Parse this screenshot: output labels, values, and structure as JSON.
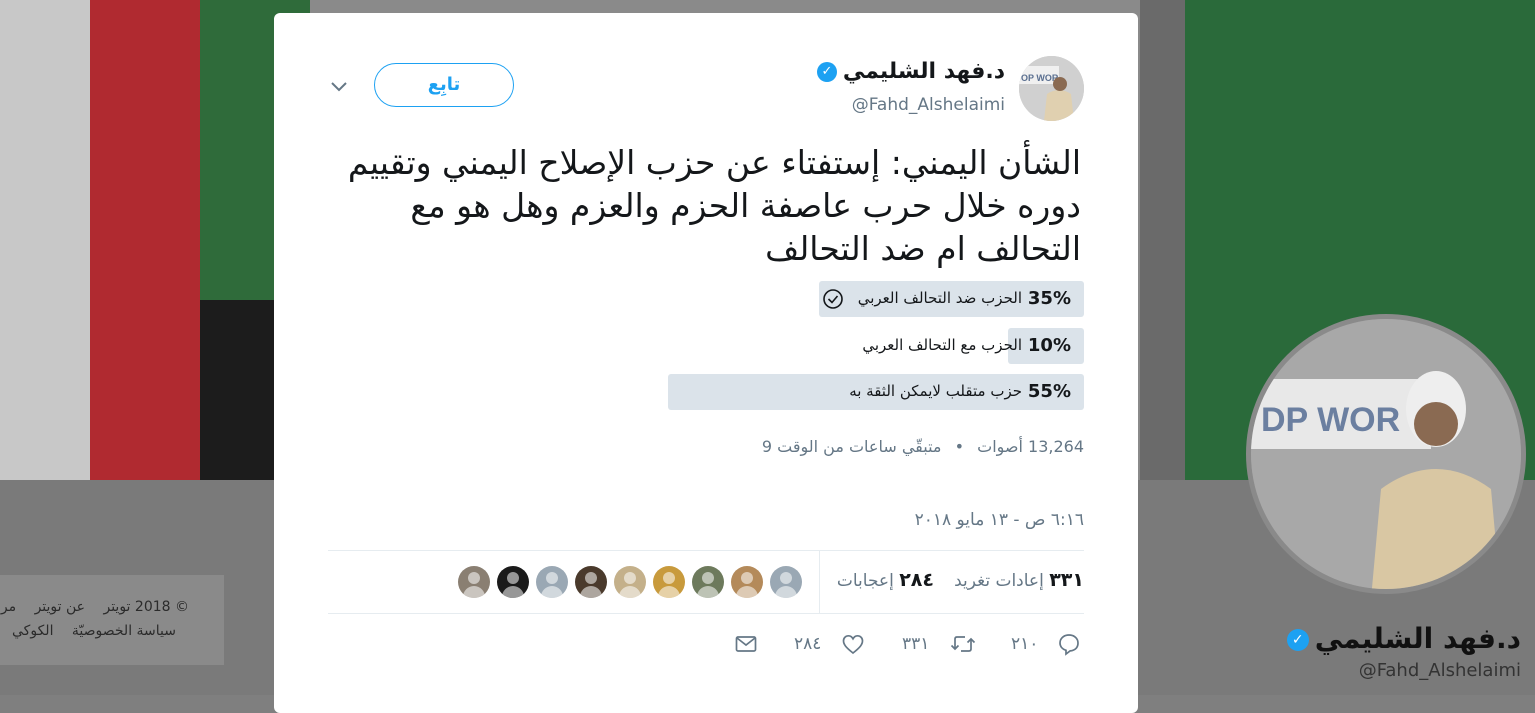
{
  "footer": {
    "line1": [
      "© 2018 تويتر",
      "عن تويتر",
      "مر"
    ],
    "line2": [
      "سياسة الخصوصيّة",
      "الكوكي"
    ]
  },
  "profile": {
    "name": "د.فهد الشليمي",
    "handle": "@Fahd_Alshelaimi"
  },
  "tweet": {
    "author_name": "د.فهد الشليمي",
    "author_handle": "@Fahd_Alshelaimi",
    "follow_label": "تابِع",
    "text": "الشأن اليمني: إستفتاء عن حزب الإصلاح اليمني وتقييم دوره خلال حرب عاصفة الحزم والعزم وهل هو مع التحالف ام ضد التحالف",
    "poll": {
      "options": [
        {
          "pct_label": "35%",
          "label": "الحزب ضد التحالف العربي",
          "fraction": 0.35,
          "selected": true
        },
        {
          "pct_label": "10%",
          "label": "الحزب مع التحالف العربي",
          "fraction": 0.1,
          "selected": false
        },
        {
          "pct_label": "55%",
          "label": "حزب متقلب لايمكن الثقة به",
          "fraction": 0.55,
          "selected": false
        }
      ],
      "votes": "13,264 أصوات",
      "separator": "•",
      "time_left": "متبقّي ساعات من الوقت 9"
    },
    "timestamp": "٦:١٦ ص - ١٣ مايو ٢٠١٨",
    "stats": {
      "retweets_count": "٣٣١",
      "retweets_label": "إعادات تغريد",
      "likes_count": "٢٨٤",
      "likes_label": "إعجابات"
    },
    "actions": {
      "reply_count": "٢١٠",
      "retweet_count": "٣٣١",
      "like_count": "٢٨٤"
    },
    "liker_colors": [
      "#9aa8b4",
      "#b48a5a",
      "#6d7a5c",
      "#c89a3c",
      "#c4b08a",
      "#4a3a2c",
      "#9aa8b4",
      "#1a1a1a",
      "#8a7f72"
    ]
  },
  "colors": {
    "accent": "#1da1f2",
    "poll_bar": "#dbe3ea",
    "muted_text": "#657786"
  }
}
